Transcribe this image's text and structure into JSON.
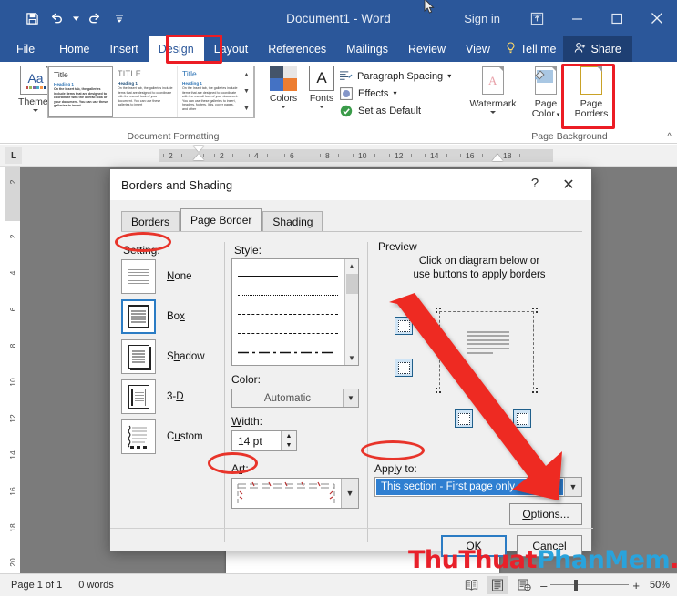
{
  "titlebar": {
    "document_title": "Document1  -  Word",
    "signin": "Sign in",
    "qat": [
      {
        "name": "save-icon",
        "label": "Save"
      },
      {
        "name": "undo-icon",
        "label": "Undo"
      },
      {
        "name": "redo-icon",
        "label": "Redo"
      },
      {
        "name": "customize-qat-icon",
        "label": "Customize Quick Access Toolbar"
      }
    ],
    "window_controls": [
      {
        "name": "ribbon-display-options-icon",
        "label": "Ribbon Display Options"
      },
      {
        "name": "minimize-icon",
        "label": "Minimize"
      },
      {
        "name": "maximize-icon",
        "label": "Maximize"
      },
      {
        "name": "close-icon",
        "label": "Close"
      }
    ]
  },
  "ribbon": {
    "tabs": [
      "File",
      "Home",
      "Insert",
      "Design",
      "Layout",
      "References",
      "Mailings",
      "Review",
      "View"
    ],
    "active_tab": "Design",
    "tellme": "Tell me",
    "share": "Share",
    "groups": [
      {
        "label": "Document Formatting"
      },
      {
        "label": "Page Background"
      }
    ],
    "themes_label": "Themes",
    "gallery": [
      {
        "title": "Title",
        "heading": "Heading 1",
        "body": "On the Insert tab, the galleries include items that are designed to coordinate with the overall look of your document. You can use these galleries to insert"
      },
      {
        "title": "TITLE",
        "heading": "Heading 1",
        "body": "On the Insert tab, the galleries include items that are designed to coordinate with the overall look of your document. You can use these galleries to insert"
      },
      {
        "title": "Title",
        "heading": "Heading 1",
        "body": "On the Insert tab, the galleries include items that are designed to coordinate with the overall look of your document. You can use these galleries to insert, headers, footers, lists, cover pages, and other"
      }
    ],
    "colors_label": "Colors",
    "fonts_label": "Fonts",
    "paragraph_spacing": "Paragraph Spacing",
    "effects": "Effects",
    "set_as_default": "Set as Default",
    "watermark_label": "Watermark",
    "page_color_label": "Page\nColor",
    "page_color_line1": "Page",
    "page_color_line2": "Color",
    "page_borders_line1": "Page",
    "page_borders_line2": "Borders"
  },
  "ruler": {
    "tab_marker": "L",
    "horizontal": [
      "2",
      "2",
      "4",
      "6",
      "8",
      "10",
      "12",
      "14",
      "16",
      "18"
    ],
    "vertical": [
      "2",
      "2",
      "4",
      "6",
      "8",
      "10",
      "12",
      "14",
      "16",
      "18",
      "20"
    ]
  },
  "dialog": {
    "title": "Borders and Shading",
    "help_icon": "?",
    "close_icon": "✕",
    "tabs": [
      "Borders",
      "Page Border",
      "Shading"
    ],
    "active_tab": "Page Border",
    "setting_label": "Setting:",
    "settings": [
      {
        "name": "None",
        "selected": false
      },
      {
        "name": "Box",
        "selected": true
      },
      {
        "name": "Shadow",
        "selected": false
      },
      {
        "name": "3-D",
        "selected": false
      },
      {
        "name": "Custom",
        "selected": false
      }
    ],
    "style_label": "Style:",
    "color_label": "Color:",
    "color_value": "Automatic",
    "width_label": "Width:",
    "width_value": "14 pt",
    "art_label": "Art:",
    "preview_label": "Preview",
    "preview_instruction_line1": "Click on diagram below or",
    "preview_instruction_line2": "use buttons to apply borders",
    "apply_to_label": "Apply to:",
    "apply_to_value": "This section - First page only",
    "options_button": "Options...",
    "ok_button": "OK",
    "cancel_button": "Cancel"
  },
  "statusbar": {
    "page": "Page 1 of 1",
    "words": "0 words",
    "views": [
      {
        "name": "read-mode-icon",
        "active": false
      },
      {
        "name": "print-layout-icon",
        "active": true
      },
      {
        "name": "web-layout-icon",
        "active": false
      }
    ],
    "zoom_out": "–",
    "zoom_in": "+",
    "zoom_level": "50%"
  },
  "watermark": {
    "part1": "ThuThuat",
    "part2": "PhanMem",
    "part3": ".vn"
  },
  "colors": {
    "word_blue": "#2b579a",
    "annotation_red": "#e8342a",
    "selection_blue": "#2f7fd1"
  }
}
